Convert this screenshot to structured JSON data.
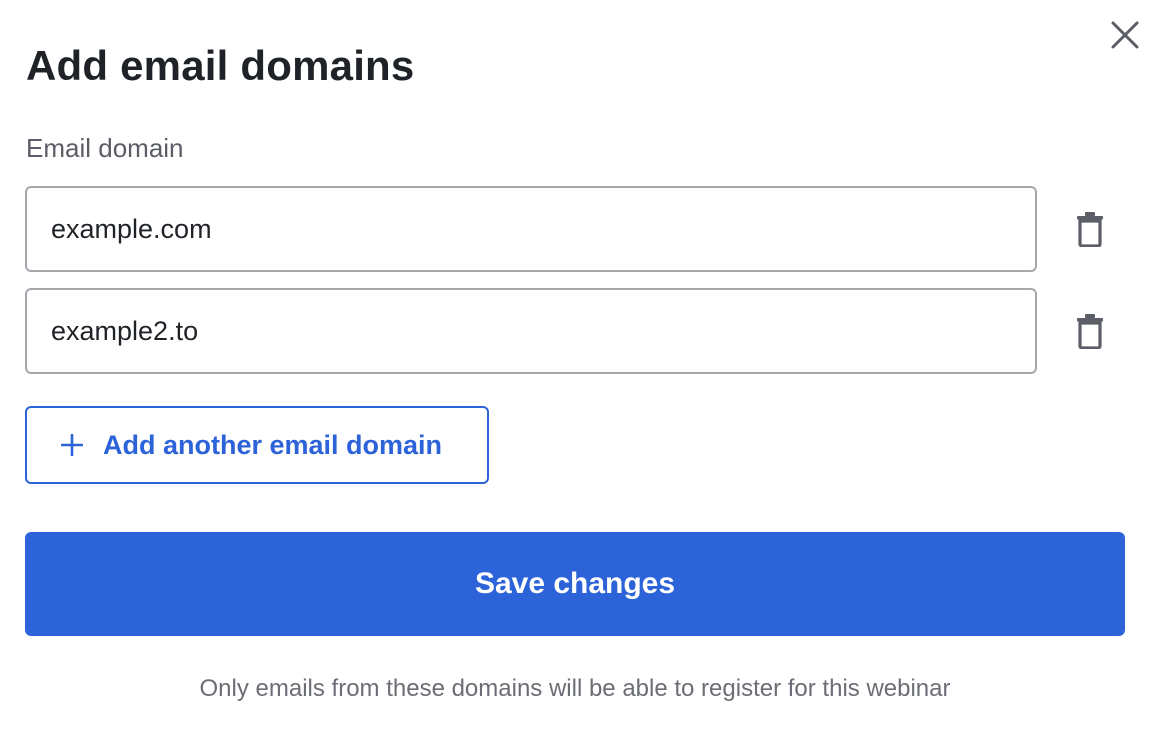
{
  "dialog": {
    "title": "Add email domains",
    "close_icon": "close-icon"
  },
  "form": {
    "field_label": "Email domain",
    "domains": [
      {
        "value": "example.com",
        "delete_icon": "trash-icon"
      },
      {
        "value": "example2.to",
        "delete_icon": "trash-icon"
      }
    ],
    "add_button": {
      "icon": "plus-icon",
      "label": "Add another email domain"
    },
    "save_button_label": "Save changes",
    "footnote": "Only emails from these domains will be able to register for this webinar"
  },
  "colors": {
    "accent": "#2d63d9",
    "title_text": "#1f2328",
    "muted_text": "#5b5e66",
    "input_border": "#a5a7ad",
    "icon_gray": "#5b5e66"
  }
}
